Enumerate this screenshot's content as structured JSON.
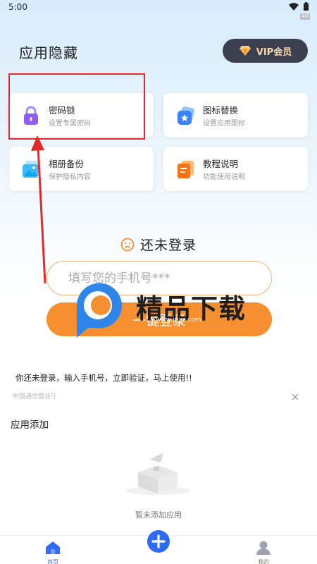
{
  "status_bar": {
    "time": "5:00",
    "network_badge": "4G"
  },
  "header": {
    "title": "应用隐藏",
    "vip_label": "VIP会员"
  },
  "features": [
    {
      "title": "密码锁",
      "subtitle": "设置专属密码",
      "icon": "lock-icon",
      "color": "#8b5cf6"
    },
    {
      "title": "图标替换",
      "subtitle": "设置应用图标",
      "icon": "app-icon-replace-icon",
      "color": "#3b82f6"
    },
    {
      "title": "相册备份",
      "subtitle": "保护隐私内容",
      "icon": "photo-album-icon",
      "color": "#38bdf8"
    },
    {
      "title": "教程说明",
      "subtitle": "功能使用说明",
      "icon": "tutorial-doc-icon",
      "color": "#f97316"
    }
  ],
  "login": {
    "status": "还未登录",
    "phone_placeholder": "填写您的手机号***",
    "button_label": "一键登录"
  },
  "watermark": {
    "text": "精品下载",
    "url": "www.jpxz.com"
  },
  "promo": {
    "message": "你还未登录，输入手机号，立即验证，马上使用!!",
    "carrier": "中国通信营业厅"
  },
  "apps_section": {
    "title": "应用添加",
    "empty_text": "暂未添加应用"
  },
  "bottom_nav": {
    "home_label": "首页",
    "mine_label": "我的"
  },
  "colors": {
    "accent": "#f58f2f",
    "primary": "#2f6bf2",
    "vip_bg": "#3c3f4f",
    "highlight": "#e12b2b"
  }
}
